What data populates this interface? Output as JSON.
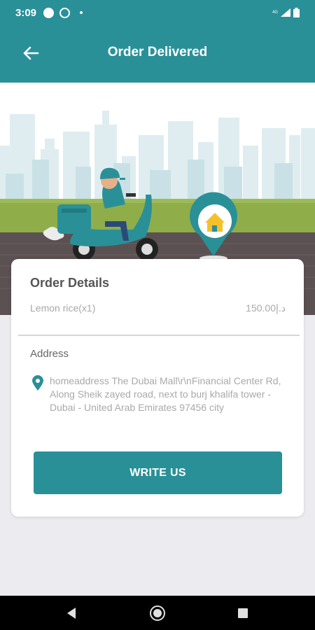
{
  "status_bar": {
    "time": "3:09",
    "network_tag": "4G",
    "icons": [
      "circle-notification-icon",
      "whatsapp-icon",
      "dot-icon",
      "signal-icon",
      "battery-icon"
    ]
  },
  "app_bar": {
    "title": "Order Delivered",
    "back_icon": "back-arrow-icon"
  },
  "colors": {
    "primary": "#2a9098",
    "background": "#ecebf0",
    "card": "#ffffff",
    "muted_text": "#a9a9a9"
  },
  "order_details": {
    "heading": "Order Details",
    "items": [
      {
        "name": "Lemon rice(x1)",
        "price": "150.00د.إ"
      }
    ]
  },
  "address": {
    "label": "Address",
    "text": "homeaddress The Dubai Mall\\r\\nFinancial Center Rd, Along Sheik zayed road, next to burj khalifa tower - Dubai - United Arab Emirates 97456 city"
  },
  "actions": {
    "write_us_label": "WRITE US"
  }
}
